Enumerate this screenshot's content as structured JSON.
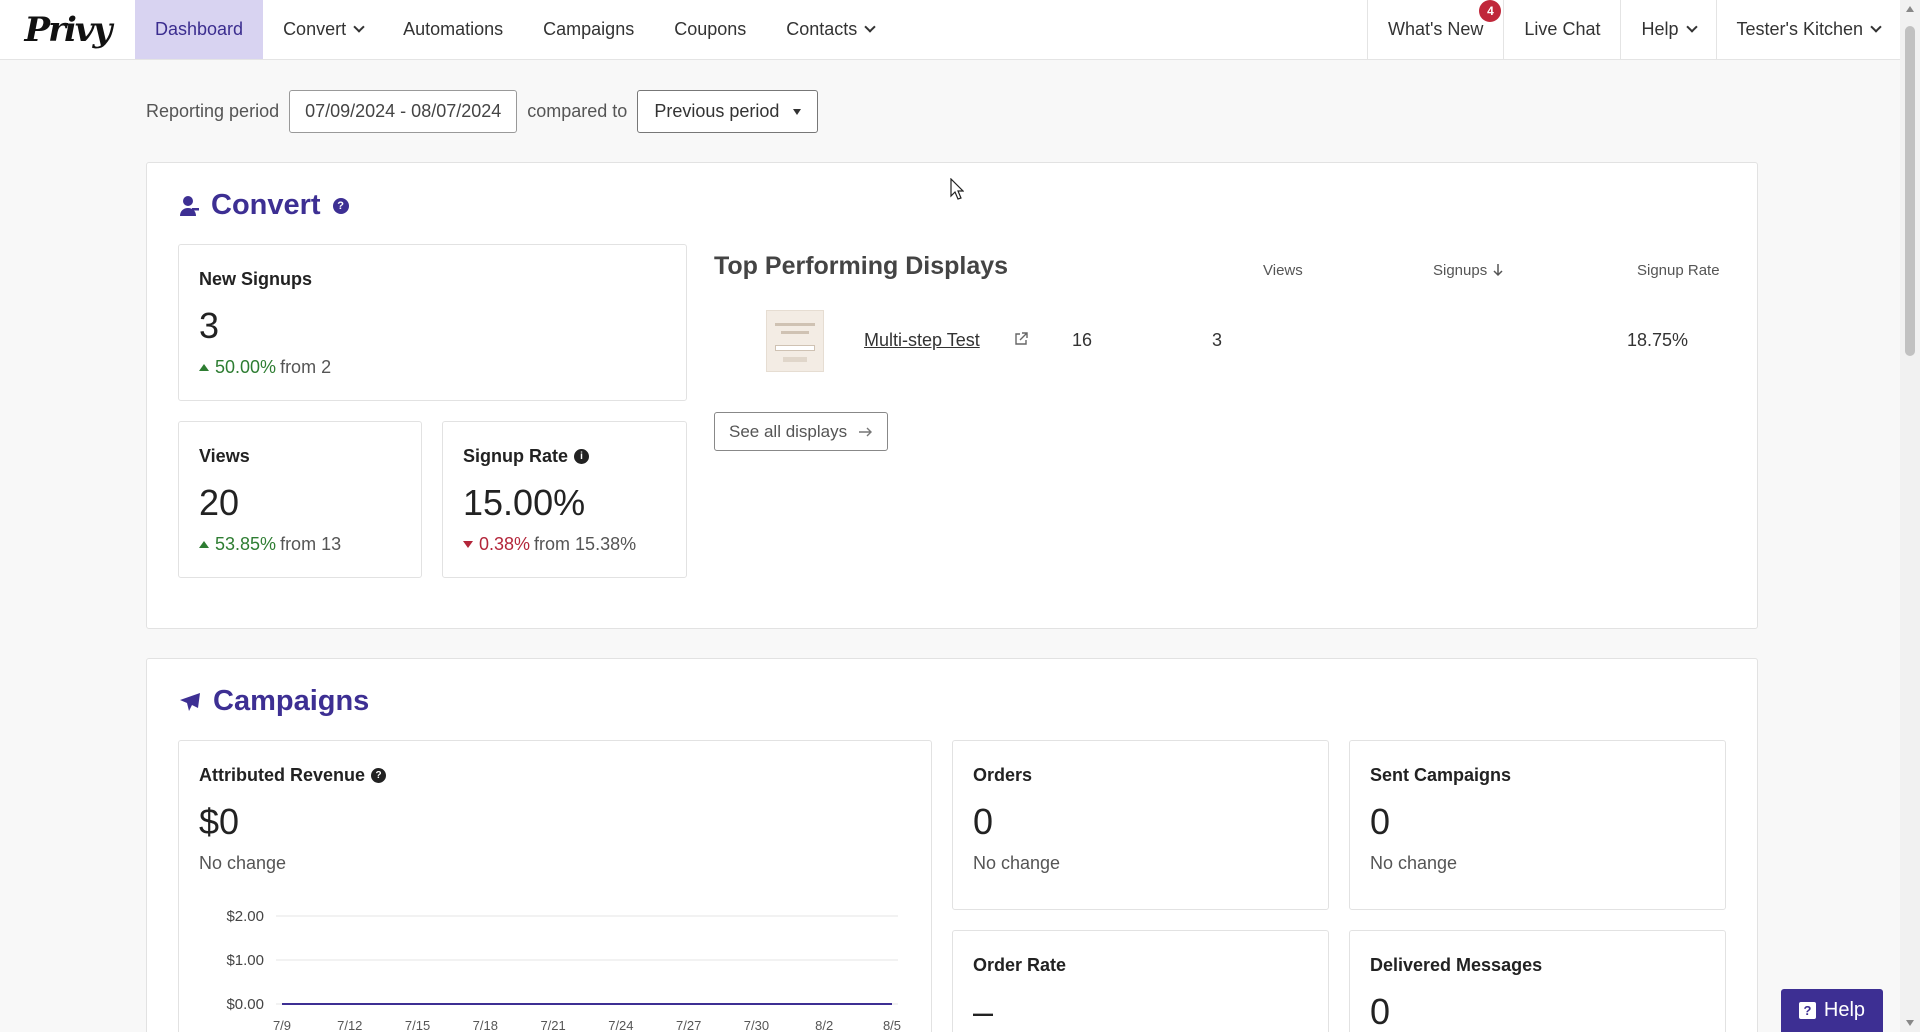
{
  "nav": {
    "logo": "Privy",
    "items": [
      {
        "label": "Dashboard",
        "active": true,
        "dropdown": false
      },
      {
        "label": "Convert",
        "active": false,
        "dropdown": true
      },
      {
        "label": "Automations",
        "active": false,
        "dropdown": false
      },
      {
        "label": "Campaigns",
        "active": false,
        "dropdown": false
      },
      {
        "label": "Coupons",
        "active": false,
        "dropdown": false
      },
      {
        "label": "Contacts",
        "active": false,
        "dropdown": true
      }
    ],
    "whats_new": "What's New",
    "whats_new_badge": "4",
    "live_chat": "Live Chat",
    "help": "Help",
    "account": "Tester's Kitchen"
  },
  "period": {
    "label": "Reporting period",
    "range": "07/09/2024 - 08/07/2024",
    "compared_label": "compared to",
    "compare_value": "Previous period"
  },
  "convert": {
    "title": "Convert",
    "new_signups": {
      "label": "New Signups",
      "value": "3",
      "change": "50.00%",
      "from": "from 2"
    },
    "views": {
      "label": "Views",
      "value": "20",
      "change": "53.85%",
      "from": "from 13"
    },
    "signup_rate": {
      "label": "Signup Rate",
      "value": "15.00%",
      "change": "0.38%",
      "from": "from 15.38%"
    },
    "top_displays": {
      "title": "Top Performing Displays",
      "columns": {
        "views": "Views",
        "signups": "Signups",
        "rate": "Signup Rate"
      },
      "rows": [
        {
          "name": "Multi-step Test",
          "views": "16",
          "signups": "3",
          "rate": "18.75%"
        }
      ],
      "see_all": "See all displays"
    }
  },
  "campaigns": {
    "title": "Campaigns",
    "revenue": {
      "label": "Attributed Revenue",
      "value": "$0",
      "change": "No change"
    },
    "orders": {
      "label": "Orders",
      "value": "0",
      "change": "No change"
    },
    "sent": {
      "label": "Sent Campaigns",
      "value": "0",
      "change": "No change"
    },
    "order_rate": {
      "label": "Order Rate",
      "value": "–"
    },
    "delivered": {
      "label": "Delivered Messages",
      "value": "0"
    }
  },
  "help_button": "Help",
  "chart_data": {
    "type": "line",
    "x": [
      "7/9",
      "7/12",
      "7/15",
      "7/18",
      "7/21",
      "7/24",
      "7/27",
      "7/30",
      "8/2",
      "8/5"
    ],
    "values": [
      0,
      0,
      0,
      0,
      0,
      0,
      0,
      0,
      0,
      0
    ],
    "yticks": [
      "$2.00",
      "$1.00",
      "$0.00"
    ],
    "ylim": [
      0,
      2
    ],
    "grid": true,
    "color": "#3d2f93"
  },
  "colors": {
    "brand": "#3d2f93",
    "active_nav": "#d8d3f1",
    "up": "#2e7d32",
    "down": "#b3263a"
  }
}
